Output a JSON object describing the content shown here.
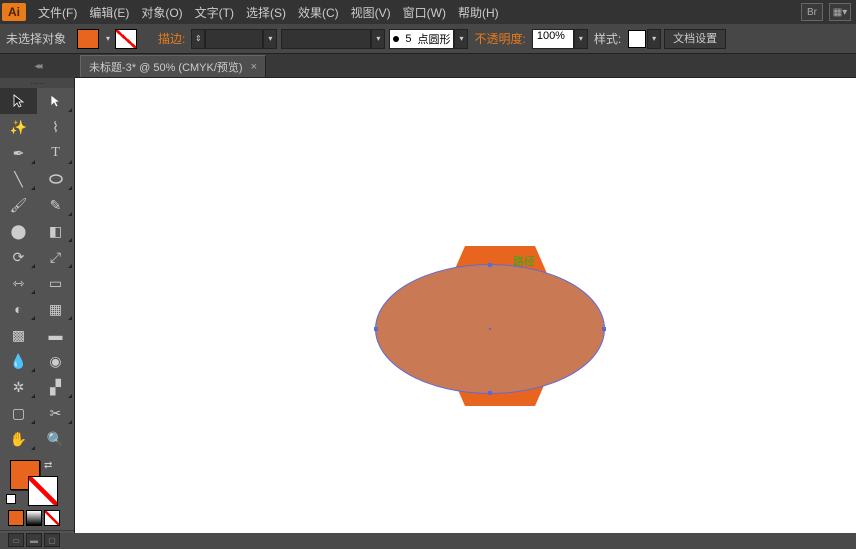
{
  "menubar": {
    "items": [
      "文件(F)",
      "编辑(E)",
      "对象(O)",
      "文字(T)",
      "选择(S)",
      "效果(C)",
      "视图(V)",
      "窗口(W)",
      "帮助(H)"
    ],
    "br_label": "Br"
  },
  "controlbar": {
    "no_selection": "未选择对象",
    "stroke_label": "描边:",
    "point_value": "5",
    "point_profile": "点圆形",
    "opacity_label": "不透明度:",
    "opacity_value": "100%",
    "style_label": "样式:",
    "doc_setup": "文档设置"
  },
  "tab": {
    "title": "未标题-3* @ 50% (CMYK/预览)"
  },
  "canvas": {
    "path_label": "路径"
  },
  "colors": {
    "fill": "#e8651f",
    "ellipse_fill": "#c97a55",
    "ellipse_stroke": "#5b6bdc"
  }
}
